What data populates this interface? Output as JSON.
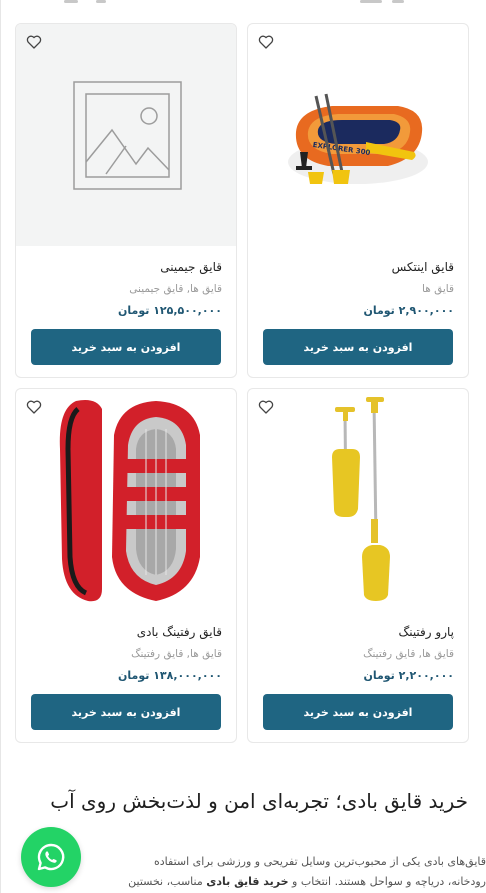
{
  "products": [
    {
      "title": "قایق اینتکس",
      "categories": "قایق ها",
      "price": "۲,۹۰۰,۰۰۰ تومان",
      "button_label": "افزودن به سبد خرید",
      "image": "inflatable-boat-explorer-photo",
      "image_text": "EXPLORER 300"
    },
    {
      "title": "قایق جیمینی",
      "categories": "قایق ها, قایق جیمینی",
      "price": "۱۲۵,۵۰۰,۰۰۰ تومان",
      "button_label": "افزودن به سبد خرید",
      "image": "image-placeholder-icon"
    },
    {
      "title": "پارو رفتینگ",
      "categories": "قایق ها, قایق رفتینگ",
      "price": "۲,۲۰۰,۰۰۰ تومان",
      "button_label": "افزودن به سبد خرید",
      "image": "yellow-paddles-photo"
    },
    {
      "title": "قایق رفتینگ بادی",
      "categories": "قایق ها, قایق رفتینگ",
      "price": "۱۳۸,۰۰۰,۰۰۰ تومان",
      "button_label": "افزودن به سبد خرید",
      "image": "red-raft-photo"
    }
  ],
  "article": {
    "heading": "خرید قایق بادی؛ تجربه‌ای امن و لذت‌بخش روی آب",
    "paragraph_line1": "قایق‌های بادی یکی از محبوب‌ترین وسایل تفریحی و ورزشی برای استفاده",
    "paragraph_line2_start": "رودخانه، دریاچه و سواحل هستند. انتخاب و ",
    "paragraph_line2_bold": "خرید قایق بادی",
    "paragraph_line2_end": " مناسب، نخستین"
  },
  "icons": {
    "wishlist": "heart-outline-icon",
    "chat": "whatsapp-icon"
  },
  "colors": {
    "button_bg": "#1f6582",
    "price": "#1f5672",
    "whatsapp": "#23d366"
  }
}
